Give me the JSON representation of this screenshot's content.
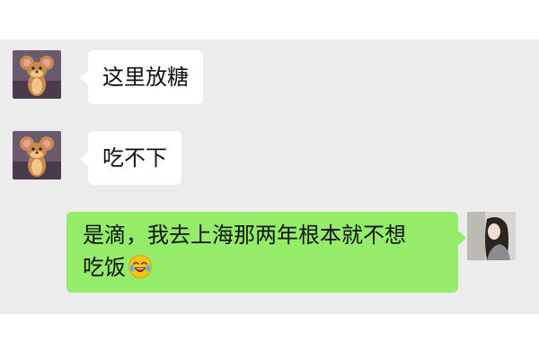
{
  "messages": [
    {
      "direction": "incoming",
      "sender_avatar": "cartoon-mouse-avatar",
      "text": "这里放糖"
    },
    {
      "direction": "incoming",
      "sender_avatar": "cartoon-mouse-avatar",
      "text": "吃不下"
    },
    {
      "direction": "outgoing",
      "sender_avatar": "girl-photo-avatar",
      "line1": "是滴，我去上海那两年根本就不想",
      "line2": "吃饭",
      "emoji": "crying-laughing-emoji"
    }
  ],
  "colors": {
    "chat_background": "#ececec",
    "incoming_bubble": "#ffffff",
    "outgoing_bubble": "#95ec69"
  }
}
